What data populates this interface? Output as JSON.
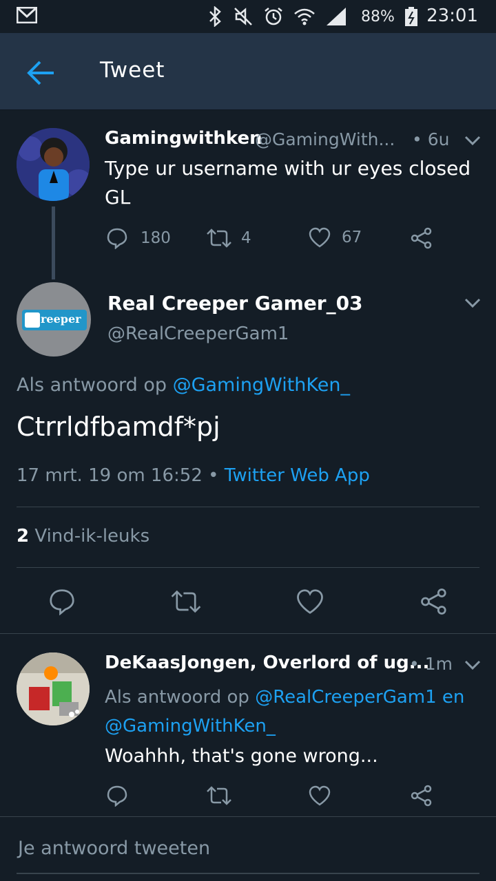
{
  "status_bar": {
    "battery_percent": "88%",
    "time": "23:01",
    "icons": [
      "gmail-icon",
      "bluetooth-icon",
      "mute-icon",
      "alarm-icon",
      "wifi-icon",
      "signal-icon",
      "battery-icon"
    ]
  },
  "app_bar": {
    "title": "Tweet",
    "back_icon": "arrow-left-icon"
  },
  "parent_tweet": {
    "name": "Gamingwithken",
    "handle": "@GamingWith...",
    "time": "• 6u",
    "text_line1": "Type ur username with ur eyes closed",
    "text_line2": "GL",
    "replies": "180",
    "retweets": "4",
    "likes": "67"
  },
  "main_tweet": {
    "name": "Real Creeper Gamer_03",
    "handle": "@RealCreeperGam1",
    "reply_to_prefix": "Als antwoord op",
    "reply_to_handle": "@GamingWithKen_",
    "text": "Ctrrldfbamdf*pj",
    "date": "17 mrt. 19 om 16:52",
    "separator": "•",
    "source": "Twitter Web App",
    "likes_count": "2",
    "likes_label": "Vind-ik-leuks",
    "avatar_text": "reeper"
  },
  "reply_tweet": {
    "name": "DeKaasJongen, Overlord of ug...",
    "time": "• 1m",
    "reply_to_prefix": "Als antwoord op",
    "reply_to_handle1": "@RealCreeperGam1",
    "reply_to_and": "en",
    "reply_to_handle2": "@GamingWithKen_",
    "text": "Woahhh, that's gone wrong..."
  },
  "compose": {
    "placeholder": "Je antwoord tweeten"
  },
  "colors": {
    "background": "#141d26",
    "app_bar": "#243447",
    "accent": "#1da1f2",
    "muted": "#8899a6",
    "divider": "#38444d"
  }
}
